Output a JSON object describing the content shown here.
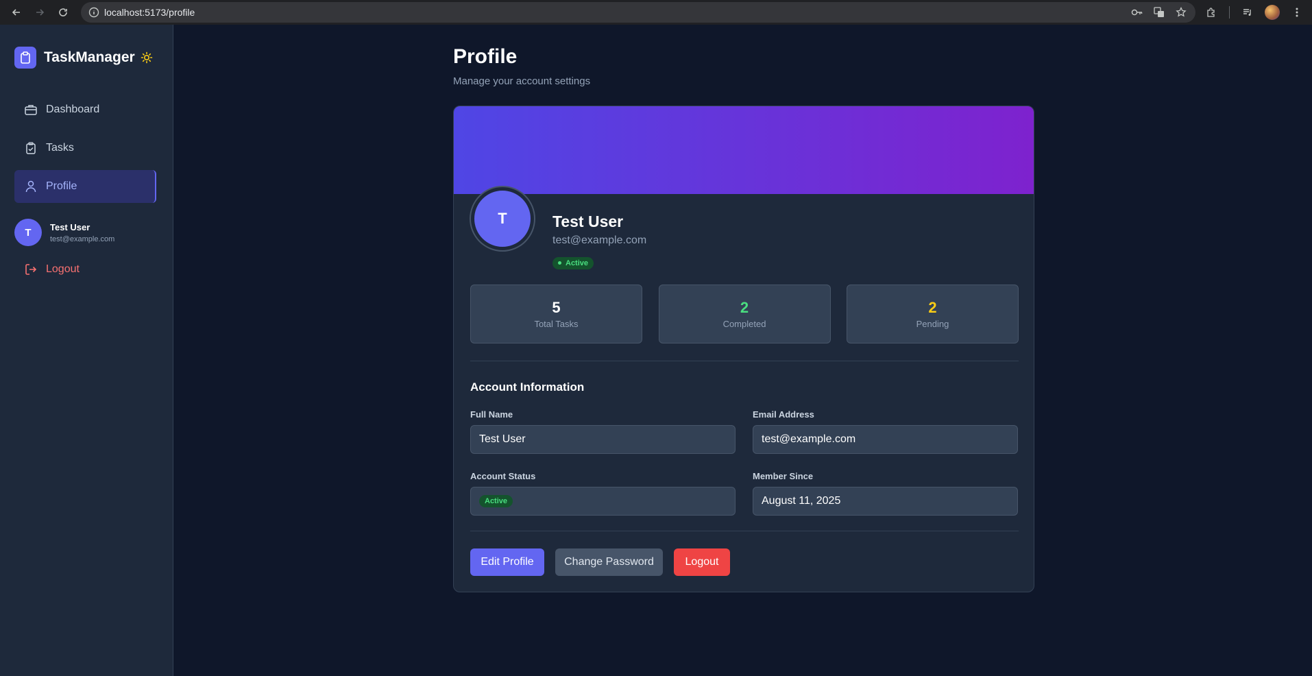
{
  "browser": {
    "url": "localhost:5173/profile"
  },
  "sidebar": {
    "app_name": "TaskManager",
    "items": [
      {
        "label": "Dashboard",
        "icon": "briefcase-icon"
      },
      {
        "label": "Tasks",
        "icon": "clipboard-check-icon"
      },
      {
        "label": "Profile",
        "icon": "user-icon",
        "active": true
      }
    ],
    "user": {
      "initial": "T",
      "name": "Test User",
      "email": "test@example.com"
    },
    "logout_label": "Logout"
  },
  "header": {
    "title": "Profile",
    "subtitle": "Manage your account settings"
  },
  "profile": {
    "initial": "T",
    "name": "Test User",
    "email": "test@example.com",
    "status_badge": "Active"
  },
  "stats": [
    {
      "value": "5",
      "label": "Total Tasks",
      "color": "#ffffff"
    },
    {
      "value": "2",
      "label": "Completed",
      "color": "#4ade80"
    },
    {
      "value": "2",
      "label": "Pending",
      "color": "#facc15"
    }
  ],
  "account": {
    "section_title": "Account Information",
    "full_name_label": "Full Name",
    "full_name_value": "Test User",
    "email_label": "Email Address",
    "email_value": "test@example.com",
    "status_label": "Account Status",
    "status_value": "Active",
    "member_label": "Member Since",
    "member_value": "August 11, 2025"
  },
  "actions": {
    "edit_label": "Edit Profile",
    "password_label": "Change Password",
    "logout_label": "Logout"
  },
  "colors": {
    "accent": "#6366f1",
    "danger": "#ef4444",
    "success": "#4ade80",
    "warning": "#facc15"
  }
}
